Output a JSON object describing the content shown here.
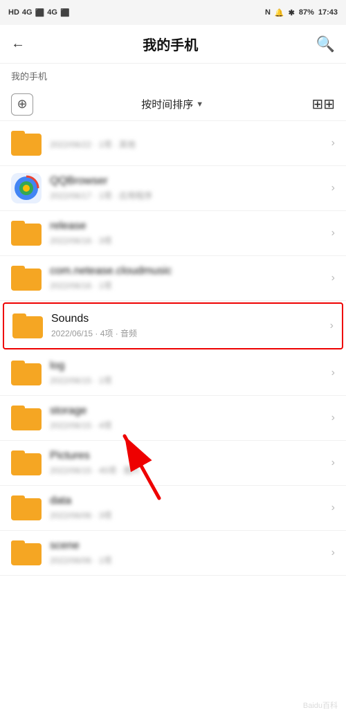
{
  "statusBar": {
    "left": "HD 4G 46 4G 46",
    "time": "17:43",
    "battery": "87%",
    "icons": "N © ✱ 🔊"
  },
  "navBar": {
    "back": "←",
    "title": "我的手机",
    "search": "🔍"
  },
  "breadcrumb": "我的手机",
  "toolbar": {
    "add": "+",
    "sort": "按时间排序",
    "sortArrow": "▼",
    "view": "⊞"
  },
  "files": [
    {
      "id": "file-1",
      "name": "",
      "meta": "2022/06/22 · 1项 · 其他",
      "type": "folder",
      "blurred": true
    },
    {
      "id": "file-qqbrowser",
      "name": "QQBrowser",
      "meta": "2022/06/17 · 1项 · 应用程序",
      "type": "browser",
      "blurred": true
    },
    {
      "id": "file-release",
      "name": "release",
      "meta": "2022/06/16 · 3项",
      "type": "folder",
      "blurred": true
    },
    {
      "id": "file-netease",
      "name": "com.netease.cloudmusic",
      "meta": "2022/06/16 · 1项",
      "type": "folder",
      "blurred": true
    },
    {
      "id": "file-sounds",
      "name": "Sounds",
      "meta": "2022/06/15 · 4项 · 音频",
      "type": "folder",
      "highlighted": true,
      "blurred": false
    },
    {
      "id": "file-log",
      "name": "log",
      "meta": "2022/06/15 · 1项",
      "type": "folder",
      "blurred": true
    },
    {
      "id": "file-storage",
      "name": "storage",
      "meta": "2022/06/15 · 4项",
      "type": "folder",
      "blurred": true
    },
    {
      "id": "file-pictures",
      "name": "Pictures",
      "meta": "2022/06/15 · 45项 · 图片",
      "type": "folder",
      "blurred": true
    },
    {
      "id": "file-data",
      "name": "data",
      "meta": "2022/06/06 · 3项",
      "type": "folder",
      "blurred": true
    },
    {
      "id": "file-scene",
      "name": "scene",
      "meta": "2022/06/06 · 1项",
      "type": "folder",
      "blurred": true
    }
  ],
  "watermark": "Baidu百科"
}
